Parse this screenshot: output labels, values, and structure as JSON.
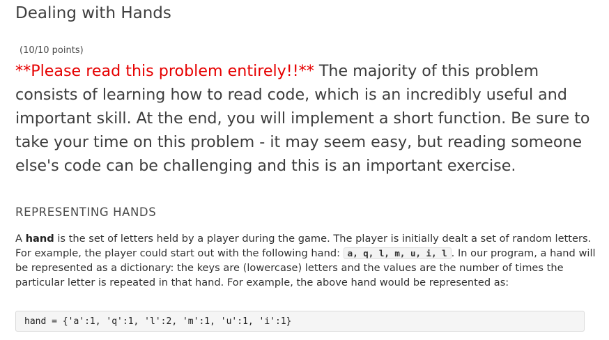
{
  "problem": {
    "title": "Dealing with Hands",
    "points": "(10/10 points)"
  },
  "intro": {
    "warning": "**Please read this problem entirely!!**",
    "text": " The majority of this problem consists of learning how to read code, which is an incredibly useful and important skill. At the end, you will implement a short function. Be sure to take your time on this problem - it may seem easy, but reading someone else's code can be challenging and this is an important exercise."
  },
  "section": {
    "heading": "REPRESENTING HANDS"
  },
  "paragraph": {
    "part1": "A ",
    "bold_word": "hand",
    "part2": " is the set of letters held by a player during the game. The player is initially dealt a set of random letters. For example, the player could start out with the following hand: ",
    "inline_code": "a, q, l, m, u, i, l",
    "part3": ". In our program, a hand will be represented as a dictionary: the keys are (lowercase) letters and the values are the number of times the particular letter is repeated in that hand. For example, the above hand would be represented as:"
  },
  "code_block": {
    "text": "hand = {'a':1, 'q':1, 'l':2, 'm':1, 'u':1, 'i':1}"
  }
}
